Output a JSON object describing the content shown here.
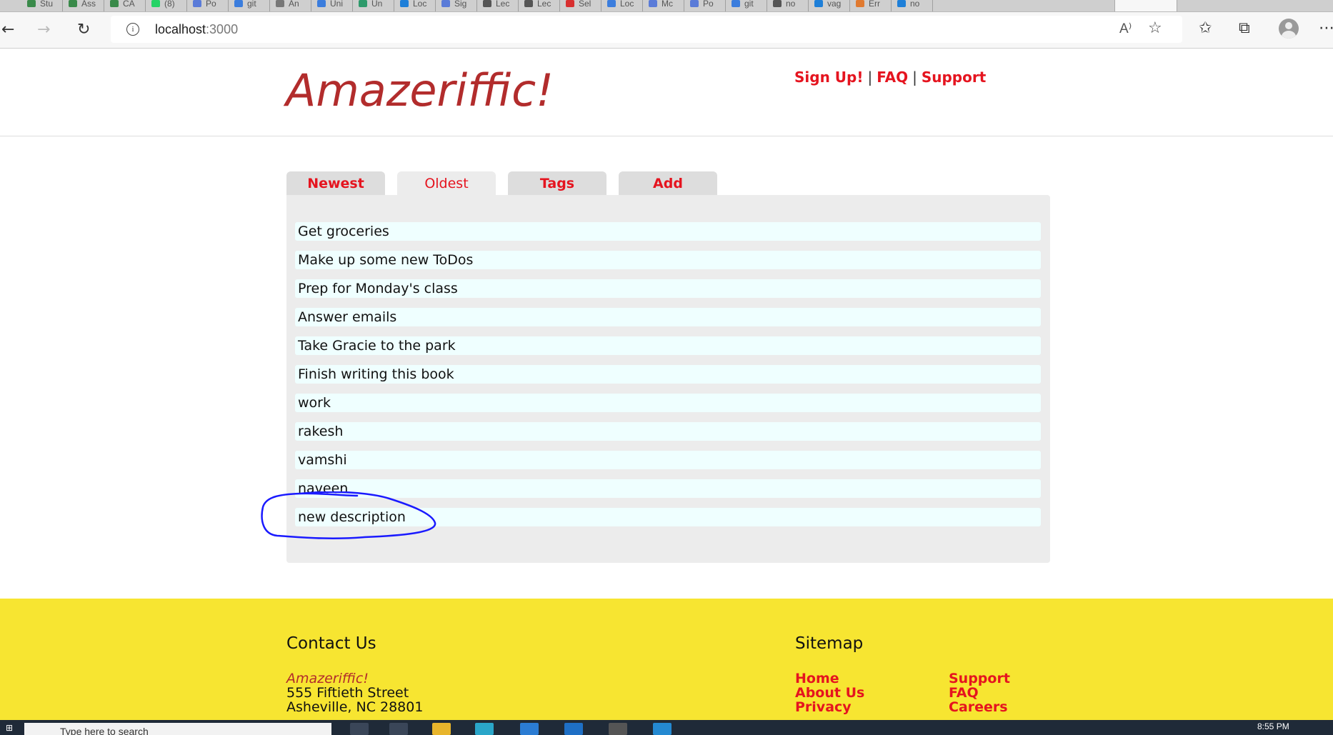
{
  "browser": {
    "url_host": "localhost",
    "url_port": ":3000",
    "tab_close": "✕",
    "tabs": [
      {
        "label": "Stu",
        "color": "#3a8a4a"
      },
      {
        "label": "Ass",
        "color": "#3a8a4a"
      },
      {
        "label": "CA",
        "color": "#3a8a4a"
      },
      {
        "label": "(8)",
        "color": "#25d366"
      },
      {
        "label": "Po",
        "color": "#5a7bd8"
      },
      {
        "label": "git",
        "color": "#3b7ddd"
      },
      {
        "label": "An",
        "color": "#777777"
      },
      {
        "label": "Uni",
        "color": "#3b7ddd"
      },
      {
        "label": "Un",
        "color": "#2e9a6b"
      },
      {
        "label": "Loc",
        "color": "#1e7fd8"
      },
      {
        "label": "Sig",
        "color": "#5a7bd8"
      },
      {
        "label": "Lec",
        "color": "#555555"
      },
      {
        "label": "Lec",
        "color": "#555555"
      },
      {
        "label": "Sel",
        "color": "#d83030"
      },
      {
        "label": "Loc",
        "color": "#3b7ddd"
      },
      {
        "label": "Mc",
        "color": "#5a7bd8"
      },
      {
        "label": "Po",
        "color": "#5a7bd8"
      },
      {
        "label": "git",
        "color": "#3b7ddd"
      },
      {
        "label": "no",
        "color": "#555555"
      },
      {
        "label": "vag",
        "color": "#1e7fd8"
      },
      {
        "label": "Err",
        "color": "#e07a30"
      },
      {
        "label": "no",
        "color": "#1e7fd8"
      }
    ]
  },
  "header": {
    "logo": "Amazeriffic!",
    "nav": {
      "signup": "Sign Up!",
      "faq": "FAQ",
      "support": "Support",
      "sep": "|"
    }
  },
  "tabs": [
    {
      "label": "Newest",
      "active": false
    },
    {
      "label": "Oldest",
      "active": true
    },
    {
      "label": "Tags",
      "active": false
    },
    {
      "label": "Add",
      "active": false
    }
  ],
  "todos": [
    "Get groceries",
    "Make up some new ToDos",
    "Prep for Monday's class",
    "Answer emails",
    "Take Gracie to the park",
    "Finish writing this book",
    "work",
    "rakesh",
    "vamshi",
    "naveen",
    "new description"
  ],
  "footer": {
    "contact_heading": "Contact Us",
    "brand": "Amazeriffic!",
    "address_line1": "555 Fiftieth Street",
    "address_line2": "Asheville, NC 28801",
    "sitemap_heading": "Sitemap",
    "sitemap_col1": [
      "Home",
      "About Us",
      "Privacy"
    ],
    "sitemap_col2": [
      "Support",
      "FAQ",
      "Careers"
    ]
  },
  "taskbar": {
    "search_placeholder": "Type here to search",
    "time": "8:55 PM"
  },
  "colors": {
    "brand": "#b22c2c",
    "link": "#e5141f",
    "footer_bg": "#f7e531",
    "todo_bg": "#efffff",
    "annotation": "#1a1aff"
  }
}
